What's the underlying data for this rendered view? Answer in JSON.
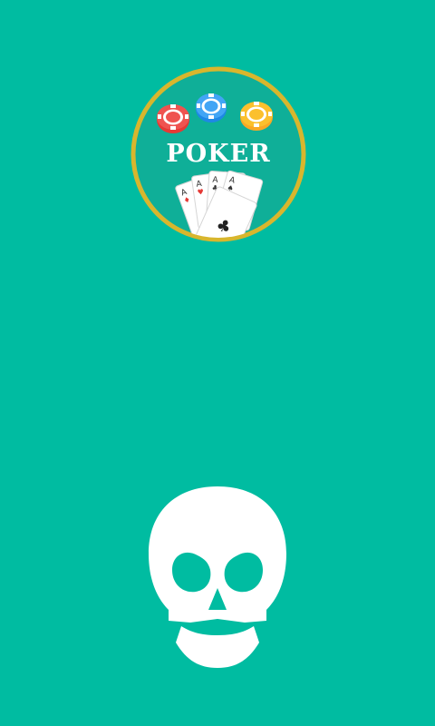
{
  "logo": {
    "title": "POKER",
    "ring_color": "#d8b62d",
    "chips": [
      "red",
      "blue",
      "yellow"
    ],
    "card_ranks": [
      "A",
      "A",
      "A",
      "A"
    ],
    "card_suits": [
      "diamond",
      "heart",
      "club",
      "spade"
    ],
    "front_card_suit": "♣"
  },
  "skull_button": {
    "icon": "skull-icon",
    "color": "#ffffff"
  },
  "theme": {
    "background": "#00bca1"
  }
}
